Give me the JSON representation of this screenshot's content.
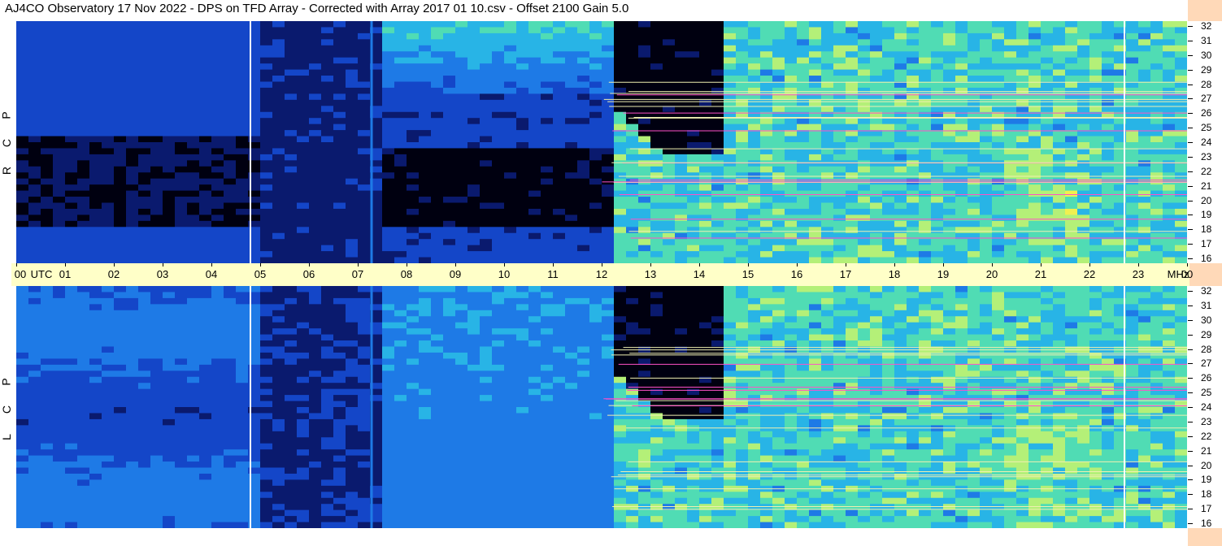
{
  "title": "AJ4CO Observatory  17 Nov 2022  -  DPS on TFD Array  -  Corrected with Array 2017 01 10.csv  -  Offset 2100  Gain 5.0",
  "chart_data": {
    "type": "heatmap",
    "title": "AJ4CO Observatory  17 Nov 2022  -  DPS on TFD Array  -  Corrected with Array 2017 01 10.csv  -  Offset 2100  Gain 5.0",
    "x_unit_label": "UTC",
    "x_ticks": [
      "00",
      "01",
      "02",
      "03",
      "04",
      "05",
      "06",
      "07",
      "08",
      "09",
      "10",
      "11",
      "12",
      "13",
      "14",
      "15",
      "16",
      "17",
      "18",
      "19",
      "20",
      "21",
      "22",
      "23",
      "00"
    ],
    "x_range_hours": [
      0,
      24
    ],
    "y_unit_label": "MHz",
    "y_ticks": [
      "32",
      "31",
      "30",
      "29",
      "28",
      "27",
      "26",
      "25",
      "24",
      "23",
      "22",
      "21",
      "20",
      "19",
      "18",
      "17",
      "16"
    ],
    "y_range_mhz": [
      16,
      32
    ],
    "panels": [
      {
        "name": "RCP",
        "label_letters": [
          "P",
          "C",
          "R"
        ]
      },
      {
        "name": "LCP",
        "label_letters": [
          "P",
          "C",
          "L"
        ]
      }
    ],
    "colormap": [
      "#000010",
      "#0a1a6e",
      "#1446c8",
      "#1e7ae6",
      "#28b4e6",
      "#50dcb4",
      "#b4f078",
      "#f0f050",
      "#ff50c8",
      "#ffffff"
    ]
  },
  "axis": {
    "utc_label": "UTC",
    "mhz_label": "MHz"
  }
}
